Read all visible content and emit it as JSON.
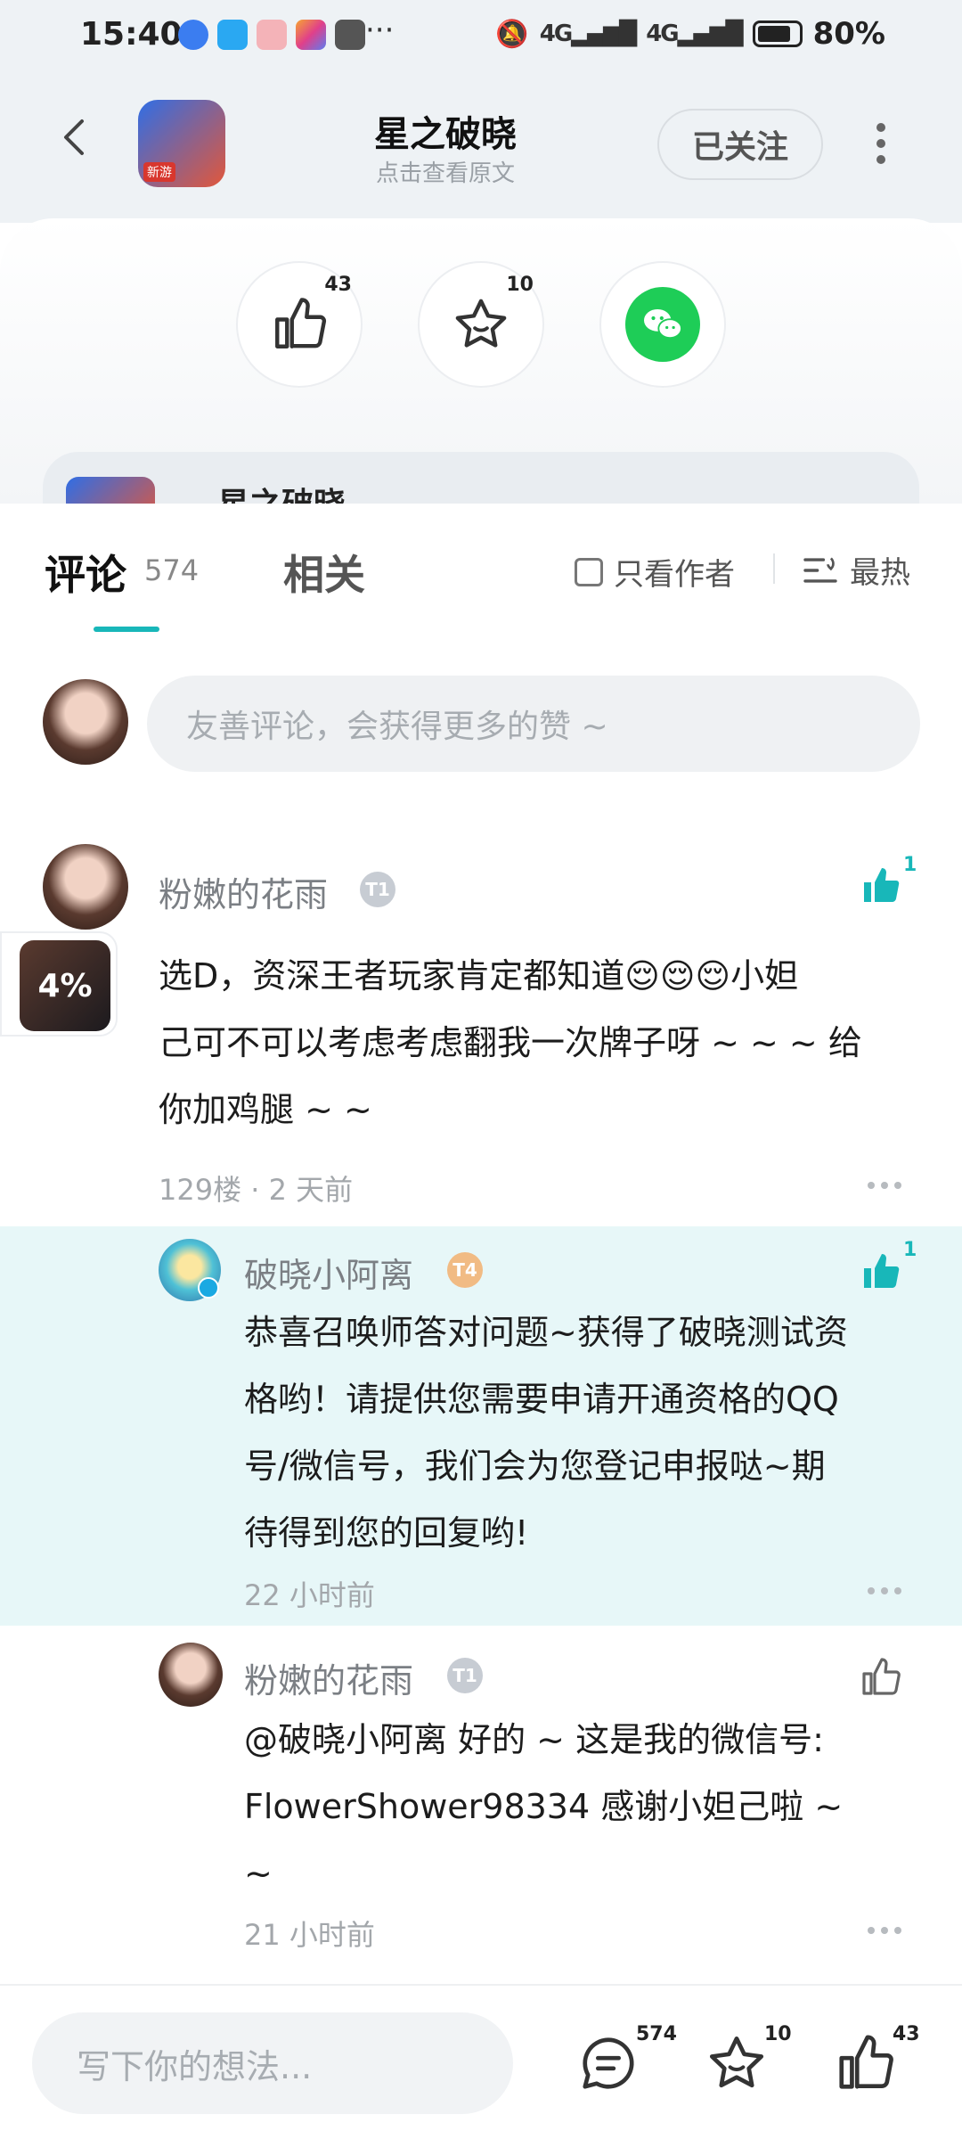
{
  "status": {
    "time": "15:40",
    "network": "4G",
    "battery": "80%"
  },
  "header": {
    "title": "星之破晓",
    "subtitle": "点击查看原文",
    "follow_label": "已关注",
    "app_badge": "新游"
  },
  "actions": {
    "like_count": "43",
    "star_count": "10"
  },
  "preview": {
    "title": "星之破晓"
  },
  "tabs": {
    "comments_label": "评论",
    "comments_count": "574",
    "related_label": "相关",
    "only_author": "只看作者",
    "sort": "最热"
  },
  "composer": {
    "placeholder": "友善评论，会获得更多的赞 ~"
  },
  "floater": {
    "label": "4%"
  },
  "comments": [
    {
      "user": "粉嫩的花雨",
      "level": "T1",
      "text_line1": "选D，资深王者玩家肯定都知道😌😌😌小妲",
      "text_line2": "己可不可以考虑考虑翻我一次牌子呀 ~ ~ ~ 给",
      "text_line3": "你加鸡腿 ~ ~",
      "meta": "129楼 · 2 天前",
      "likes": "1"
    },
    {
      "user": "破晓小阿离",
      "level": "T4",
      "text_line1": "恭喜召唤师答对问题~获得了破晓测试资",
      "text_line2": "格哟！请提供您需要申请开通资格的QQ",
      "text_line3": "号/微信号，我们会为您登记申报哒~期",
      "text_line4": "待得到您的回复哟!",
      "meta": "22 小时前",
      "likes": "1"
    },
    {
      "user": "粉嫩的花雨",
      "level": "T1",
      "text_line1": "@破晓小阿离  好的 ~ 这是我的微信号:",
      "text_line2": "FlowerShower98334  感谢小妲己啦 ~",
      "text_line3": "~",
      "meta": "21 小时前"
    }
  ],
  "bottom": {
    "placeholder": "写下你的想法...",
    "comment_count": "574",
    "star_count": "10",
    "like_count": "43"
  },
  "colors": {
    "accent": "#18b7b9",
    "wechat": "#1ecd57",
    "reply_bg": "#e7f7f8"
  }
}
